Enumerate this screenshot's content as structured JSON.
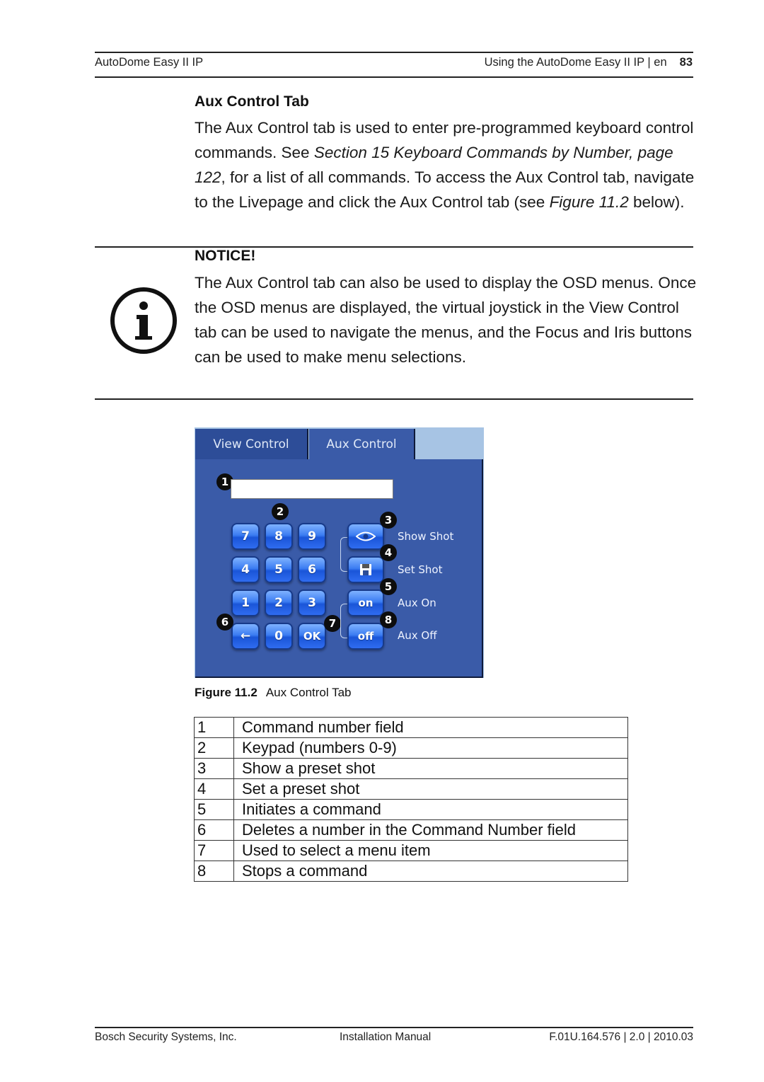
{
  "header": {
    "product": "AutoDome Easy II IP",
    "section": "Using the AutoDome Easy II IP | en",
    "page_number": "83"
  },
  "section": {
    "title": "Aux Control Tab",
    "paragraph": [
      {
        "text": "The Aux Control tab is used to enter pre-programmed keyboard control commands. See ",
        "italic": false
      },
      {
        "text": "Section 15 Keyboard Commands by Number, page 122",
        "italic": true
      },
      {
        "text": ", for a list of all commands. To access the Aux Control tab, navigate to the Livepage and click the Aux Control tab (see ",
        "italic": false
      },
      {
        "text": "Figure 11.2",
        "italic": true
      },
      {
        "text": " below).",
        "italic": false
      }
    ]
  },
  "notice": {
    "title": "NOTICE!",
    "icon": "info-icon",
    "text": "The Aux Control tab can also be used to display the OSD menus. Once the OSD menus are displayed, the virtual joystick in the View Control tab can be used to navigate the menus, and the Focus and Iris buttons can be used to make menu selections."
  },
  "figure": {
    "tabs": [
      {
        "label": "View Control",
        "active": false
      },
      {
        "label": "Aux Control",
        "active": true
      }
    ],
    "command_field_value": "",
    "keypad": [
      "7",
      "8",
      "9",
      "4",
      "5",
      "6",
      "1",
      "2",
      "3",
      "←",
      "0",
      "OK"
    ],
    "action_buttons": [
      {
        "icon": "eye-icon",
        "label": "Show Shot"
      },
      {
        "icon": "floppy-disk-icon",
        "label": "Set Shot"
      },
      {
        "icon": "",
        "text": "on",
        "label": "Aux On"
      },
      {
        "icon": "",
        "text": "off",
        "label": "Aux Off"
      }
    ],
    "callouts": [
      "1",
      "2",
      "3",
      "4",
      "5",
      "6",
      "7",
      "8"
    ],
    "colors": {
      "panel": "#3a5ba8",
      "tab_strip": "#a7c4e4",
      "button": "#2f6cf0"
    },
    "caption_label": "Figure  11.2",
    "caption_text": "Aux Control Tab"
  },
  "legend": [
    {
      "num": "1",
      "desc": "Command number field"
    },
    {
      "num": "2",
      "desc": "Keypad (numbers 0-9)"
    },
    {
      "num": "3",
      "desc": "Show a preset shot"
    },
    {
      "num": "4",
      "desc": "Set a preset shot"
    },
    {
      "num": "5",
      "desc": "Initiates a command"
    },
    {
      "num": "6",
      "desc": "Deletes a number in the Command Number field"
    },
    {
      "num": "7",
      "desc": "Used to select a menu item"
    },
    {
      "num": "8",
      "desc": "Stops a command"
    }
  ],
  "footer": {
    "company": "Bosch Security Systems, Inc.",
    "doc_type": "Installation Manual",
    "doc_id": "F.01U.164.576 | 2.0 | 2010.03"
  }
}
